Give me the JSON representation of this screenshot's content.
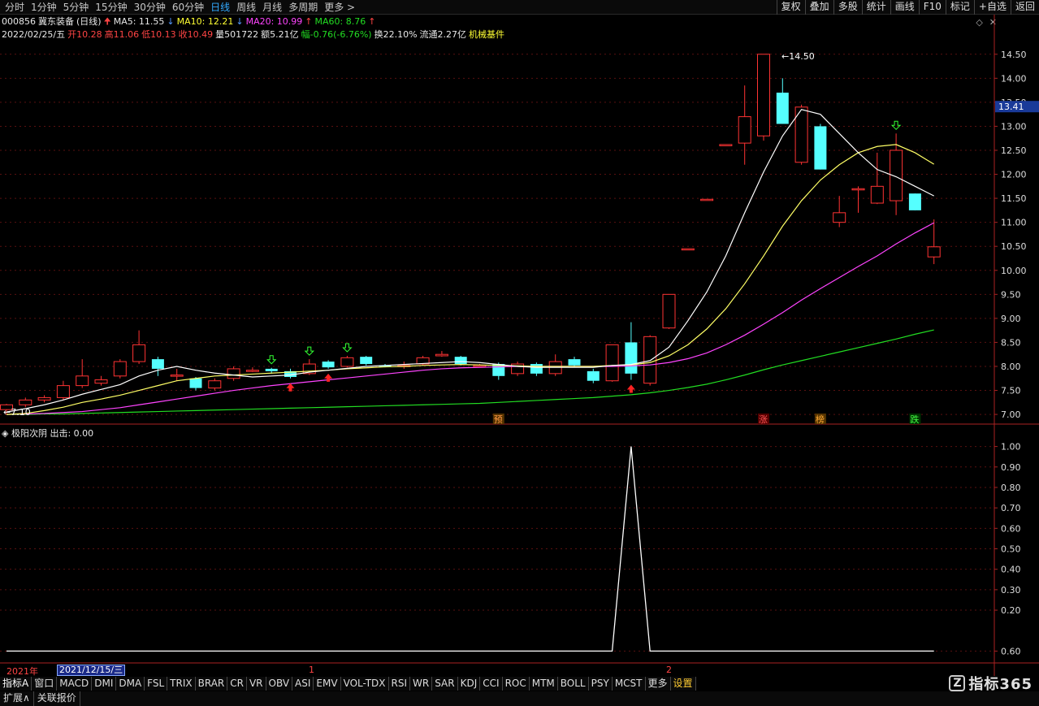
{
  "toolbar": {
    "periods": [
      "分时",
      "1分钟",
      "5分钟",
      "15分钟",
      "30分钟",
      "60分钟",
      "日线",
      "周线",
      "月线",
      "多周期",
      "更多 >"
    ],
    "active_period": "日线",
    "right_tools": [
      "复权",
      "叠加",
      "多股",
      "统计",
      "画线",
      "F10",
      "标记",
      "+自选",
      "返回"
    ]
  },
  "stock": {
    "code": "000856",
    "name": "冀东装备",
    "period": "(日线)",
    "ma5": "MA5: 11.55",
    "ma10": "MA10: 12.21",
    "ma20": "MA20: 10.99",
    "ma60": "MA60: 8.76",
    "date": "2022/02/25/五",
    "open": "开10.28",
    "high": "高11.06",
    "low": "低10.13",
    "close": "收10.49",
    "volume": "量501722",
    "amount": "额5.21亿",
    "change": "幅-0.76(-6.76%)",
    "turnover": "换22.10%",
    "float": "流通2.27亿",
    "sector": "机械基件"
  },
  "indicator": {
    "name": "极阳次阴",
    "output": "出击: 0.00"
  },
  "dates": {
    "year": "2021年",
    "cursor": "2021/12/15/三",
    "m1": "1",
    "m2": "2"
  },
  "indicator_tabs": [
    "指标A",
    "窗口",
    "MACD",
    "DMI",
    "DMA",
    "FSL",
    "TRIX",
    "BRAR",
    "CR",
    "VR",
    "OBV",
    "ASI",
    "EMV",
    "VOL-TDX",
    "RSI",
    "WR",
    "SAR",
    "KDJ",
    "CCI",
    "ROC",
    "MTM",
    "BOLL",
    "PSY",
    "MCST",
    "更多",
    "设置"
  ],
  "bottom_tabs": [
    "扩展∧",
    "关联报价"
  ],
  "logo": {
    "text": "指标365",
    "icon": "Z"
  },
  "chart_data": [
    {
      "type": "candlestick",
      "y_ticks": [
        "14.50",
        "14.00",
        "13.50",
        "13.00",
        "12.50",
        "12.00",
        "11.50",
        "11.00",
        "10.50",
        "10.00",
        "9.50",
        "9.00",
        "8.50",
        "8.00",
        "7.50",
        "7.00"
      ],
      "ylim": [
        6.9,
        14.75
      ],
      "current_price_label": "13.41",
      "current_price": 13.41,
      "high_label": "14.50",
      "low_label": "7.10",
      "markers": {
        "yu": "预",
        "zhang": "涨",
        "bang": "榜",
        "die": "跌"
      },
      "candles": [
        {
          "o": 7.1,
          "h": 7.22,
          "l": 7.0,
          "c": 7.2
        },
        {
          "o": 7.2,
          "h": 7.35,
          "l": 7.15,
          "c": 7.3
        },
        {
          "o": 7.3,
          "h": 7.4,
          "l": 7.25,
          "c": 7.35
        },
        {
          "o": 7.35,
          "h": 7.7,
          "l": 7.3,
          "c": 7.6
        },
        {
          "o": 7.6,
          "h": 8.15,
          "l": 7.55,
          "c": 7.8
        },
        {
          "o": 7.65,
          "h": 7.8,
          "l": 7.6,
          "c": 7.72
        },
        {
          "o": 7.8,
          "h": 8.15,
          "l": 7.75,
          "c": 8.1
        },
        {
          "o": 8.1,
          "h": 8.75,
          "l": 8.05,
          "c": 8.45
        },
        {
          "o": 8.15,
          "h": 8.2,
          "l": 7.8,
          "c": 7.95
        },
        {
          "o": 7.8,
          "h": 7.95,
          "l": 7.7,
          "c": 7.82
        },
        {
          "o": 7.75,
          "h": 7.78,
          "l": 7.5,
          "c": 7.55
        },
        {
          "o": 7.55,
          "h": 7.75,
          "l": 7.5,
          "c": 7.7
        },
        {
          "o": 7.75,
          "h": 8.0,
          "l": 7.7,
          "c": 7.95
        },
        {
          "o": 7.92,
          "h": 7.98,
          "l": 7.88,
          "c": 7.92
        },
        {
          "o": 7.95,
          "h": 7.97,
          "l": 7.85,
          "c": 7.9
        },
        {
          "o": 7.9,
          "h": 7.95,
          "l": 7.75,
          "c": 7.78
        },
        {
          "o": 7.85,
          "h": 8.15,
          "l": 7.82,
          "c": 8.05
        },
        {
          "o": 8.1,
          "h": 8.13,
          "l": 7.95,
          "c": 7.98
        },
        {
          "o": 8.0,
          "h": 8.22,
          "l": 7.98,
          "c": 8.18
        },
        {
          "o": 8.2,
          "h": 8.22,
          "l": 8.02,
          "c": 8.05
        },
        {
          "o": 8.02,
          "h": 8.05,
          "l": 7.98,
          "c": 8.0
        },
        {
          "o": 8.0,
          "h": 8.1,
          "l": 7.95,
          "c": 8.02
        },
        {
          "o": 8.05,
          "h": 8.22,
          "l": 8.02,
          "c": 8.18
        },
        {
          "o": 8.22,
          "h": 8.32,
          "l": 8.2,
          "c": 8.25
        },
        {
          "o": 8.2,
          "h": 8.22,
          "l": 8.02,
          "c": 8.05
        },
        {
          "o": 8.0,
          "h": 8.05,
          "l": 7.98,
          "c": 8.02
        },
        {
          "o": 8.05,
          "h": 8.08,
          "l": 7.72,
          "c": 7.8
        },
        {
          "o": 7.85,
          "h": 8.1,
          "l": 7.8,
          "c": 8.05
        },
        {
          "o": 8.05,
          "h": 8.08,
          "l": 7.8,
          "c": 7.85
        },
        {
          "o": 7.85,
          "h": 8.25,
          "l": 7.8,
          "c": 8.1
        },
        {
          "o": 8.15,
          "h": 8.2,
          "l": 7.98,
          "c": 8.02
        },
        {
          "o": 7.9,
          "h": 7.95,
          "l": 7.65,
          "c": 7.7
        },
        {
          "o": 7.7,
          "h": 8.45,
          "l": 7.68,
          "c": 8.45
        },
        {
          "o": 8.5,
          "h": 8.92,
          "l": 7.72,
          "c": 7.85
        },
        {
          "o": 7.65,
          "h": 8.65,
          "l": 7.6,
          "c": 8.62
        },
        {
          "o": 8.8,
          "h": 9.5,
          "l": 8.78,
          "c": 9.5
        },
        {
          "o": 10.45,
          "h": 10.45,
          "l": 10.45,
          "c": 10.45
        },
        {
          "o": 11.48,
          "h": 11.48,
          "l": 11.48,
          "c": 11.48
        },
        {
          "o": 12.62,
          "h": 12.62,
          "l": 12.62,
          "c": 12.62
        },
        {
          "o": 12.65,
          "h": 13.85,
          "l": 12.2,
          "c": 13.2
        },
        {
          "o": 12.8,
          "h": 14.5,
          "l": 12.7,
          "c": 14.5
        },
        {
          "o": 13.7,
          "h": 14.0,
          "l": 13.05,
          "c": 13.05
        },
        {
          "o": 12.25,
          "h": 13.45,
          "l": 12.2,
          "c": 13.4
        },
        {
          "o": 13.0,
          "h": 13.05,
          "l": 12.1,
          "c": 12.1
        },
        {
          "o": 11.0,
          "h": 11.55,
          "l": 10.9,
          "c": 11.2
        },
        {
          "o": 11.7,
          "h": 11.75,
          "l": 11.2,
          "c": 11.7
        },
        {
          "o": 11.4,
          "h": 12.45,
          "l": 11.38,
          "c": 11.75
        },
        {
          "o": 11.45,
          "h": 12.85,
          "l": 11.15,
          "c": 12.5
        },
        {
          "o": 11.6,
          "h": 11.6,
          "l": 11.25,
          "c": 11.25
        },
        {
          "o": 10.28,
          "h": 11.06,
          "l": 10.13,
          "c": 10.49
        }
      ],
      "ma5": [
        7.05,
        7.12,
        7.2,
        7.3,
        7.42,
        7.52,
        7.62,
        7.8,
        7.92,
        8.0,
        7.92,
        7.86,
        7.82,
        7.78,
        7.8,
        7.82,
        7.88,
        7.92,
        7.96,
        8.0,
        8.02,
        8.04,
        8.06,
        8.08,
        8.1,
        8.08,
        8.04,
        8.0,
        7.98,
        7.98,
        7.98,
        7.98,
        8.02,
        8.04,
        8.12,
        8.4,
        8.95,
        9.55,
        10.3,
        11.2,
        12.05,
        12.8,
        13.35,
        13.25,
        12.85,
        12.45,
        12.1,
        11.95,
        11.75,
        11.55
      ],
      "ma10": [
        7.0,
        7.02,
        7.08,
        7.15,
        7.25,
        7.32,
        7.4,
        7.5,
        7.6,
        7.7,
        7.75,
        7.8,
        7.82,
        7.84,
        7.86,
        7.88,
        7.9,
        7.92,
        7.95,
        7.97,
        7.99,
        8.0,
        8.02,
        8.03,
        8.04,
        8.03,
        8.02,
        8.01,
        8.0,
        8.0,
        8.0,
        8.0,
        8.02,
        8.03,
        8.08,
        8.22,
        8.45,
        8.78,
        9.2,
        9.72,
        10.3,
        10.92,
        11.45,
        11.88,
        12.2,
        12.45,
        12.58,
        12.62,
        12.45,
        12.21
      ],
      "ma20": [
        7.0,
        7.01,
        7.02,
        7.04,
        7.06,
        7.1,
        7.14,
        7.2,
        7.26,
        7.32,
        7.38,
        7.44,
        7.5,
        7.55,
        7.6,
        7.64,
        7.68,
        7.72,
        7.76,
        7.8,
        7.84,
        7.88,
        7.92,
        7.95,
        7.97,
        7.98,
        7.99,
        8.0,
        8.0,
        8.0,
        8.0,
        8.0,
        8.0,
        8.01,
        8.03,
        8.08,
        8.16,
        8.28,
        8.45,
        8.65,
        8.88,
        9.12,
        9.38,
        9.62,
        9.85,
        10.08,
        10.3,
        10.55,
        10.78,
        10.99
      ],
      "ma60": [
        7.0,
        7.0,
        7.01,
        7.01,
        7.02,
        7.03,
        7.04,
        7.05,
        7.06,
        7.07,
        7.08,
        7.09,
        7.1,
        7.11,
        7.12,
        7.13,
        7.14,
        7.15,
        7.16,
        7.17,
        7.18,
        7.19,
        7.2,
        7.21,
        7.22,
        7.23,
        7.25,
        7.27,
        7.29,
        7.31,
        7.33,
        7.35,
        7.38,
        7.41,
        7.45,
        7.5,
        7.56,
        7.63,
        7.72,
        7.82,
        7.93,
        8.03,
        8.12,
        8.21,
        8.3,
        8.39,
        8.48,
        8.57,
        8.67,
        8.76
      ],
      "buy_arrows": [
        15,
        17,
        33
      ],
      "sell_arrows": [
        14,
        16,
        18,
        47
      ]
    },
    {
      "type": "line",
      "y_ticks": [
        "1.00",
        "0.90",
        "0.80",
        "0.70",
        "0.60",
        "0.50",
        "0.40",
        "0.30",
        "0.20",
        "0.60"
      ],
      "ylim": [
        -0.05,
        1.05
      ],
      "values": [
        0,
        0,
        0,
        0,
        0,
        0,
        0,
        0,
        0,
        0,
        0,
        0,
        0,
        0,
        0,
        0,
        0,
        0,
        0,
        0,
        0,
        0,
        0,
        0,
        0,
        0,
        0,
        0,
        0,
        0,
        0,
        0,
        0,
        1,
        0,
        0,
        0,
        0,
        0,
        0,
        0,
        0,
        0,
        0,
        0,
        0,
        0,
        0,
        0,
        0
      ]
    }
  ]
}
